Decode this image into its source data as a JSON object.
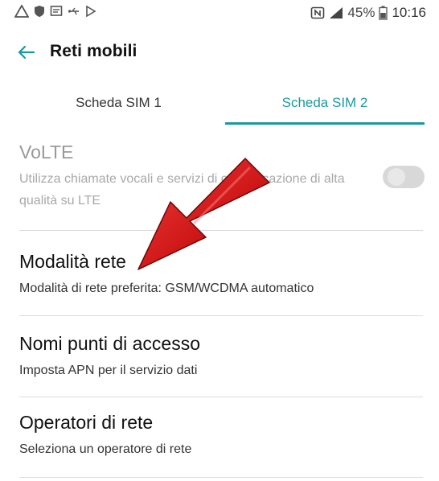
{
  "status_bar": {
    "battery_percent": "45%",
    "time": "10:16",
    "left_icons": [
      "warning-icon",
      "shield-icon",
      "message-icon",
      "usb-icon",
      "play-icon"
    ],
    "right_icons": [
      "nfc-icon",
      "signal-icon",
      "battery-icon"
    ]
  },
  "app_bar": {
    "title": "Reti mobili",
    "back_icon": "arrow-left-icon"
  },
  "tabs": [
    {
      "label": "Scheda SIM 1",
      "selected": false
    },
    {
      "label": "Scheda SIM 2",
      "selected": true
    }
  ],
  "settings": [
    {
      "title": "VoLTE",
      "summary": "Utilizza chiamate vocali e servizi di comunicazione di alta qualità su LTE",
      "enabled": false,
      "toggle_on": false
    },
    {
      "title": "Modalità rete",
      "summary": "Modalità di rete preferita: GSM/WCDMA automatico"
    },
    {
      "title": "Nomi punti di accesso",
      "summary": "Imposta APN per il servizio dati"
    },
    {
      "title": "Operatori di rete",
      "summary": "Seleziona un operatore di rete"
    }
  ],
  "colors": {
    "accent": "#1a9aa0",
    "annotation_arrow": "#d42020"
  }
}
